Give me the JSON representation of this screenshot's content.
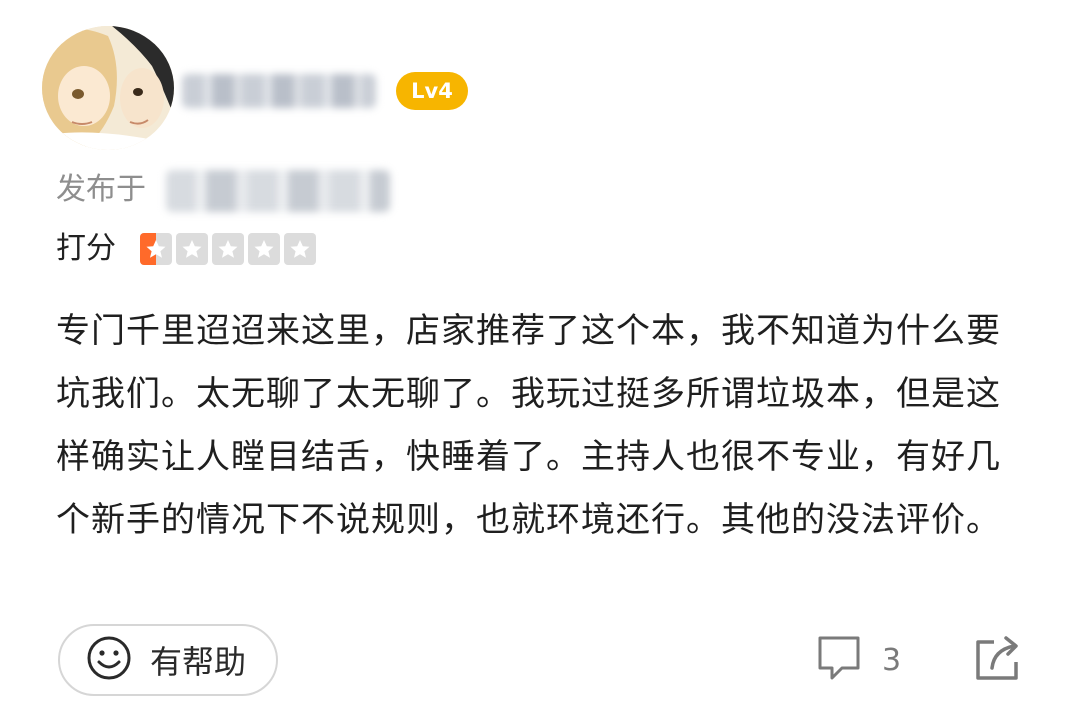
{
  "user": {
    "avatar_icon": "anime-avatar",
    "level_badge": "Lv4",
    "level_color": "#f7b500"
  },
  "meta": {
    "published_label": "发布于",
    "rating_label": "打分",
    "rating_value": 0.5,
    "rating_max": 5,
    "star_color": "#ff6a2a",
    "star_empty_color": "#dcdcdc"
  },
  "review": {
    "text": "专门千里迢迢来这里，店家推荐了这个本，我不知道为什么要坑我们。太无聊了太无聊了。我玩过挺多所谓垃圾本，但是这样确实让人瞠目结舌，快睡着了。主持人也很不专业，有好几个新手的情况下不说规则，也就环境还行。其他的没法评价。"
  },
  "actions": {
    "helpful_label": "有帮助",
    "helpful_icon": "smile-icon",
    "comment_icon": "comment-icon",
    "comment_count": "3",
    "share_icon": "share-icon"
  }
}
